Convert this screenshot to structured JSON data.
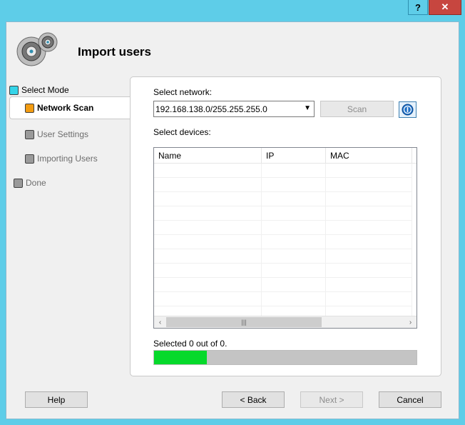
{
  "titlebar": {
    "help_label": "?",
    "close_label": "✕"
  },
  "header": {
    "title": "Import users",
    "logo_icon": "gears-icon"
  },
  "steps": [
    {
      "label": "Select Mode",
      "color": "#35d4e8",
      "state": "done"
    },
    {
      "label": "Network Scan",
      "color": "#f39c12",
      "state": "active"
    },
    {
      "label": "User Settings",
      "color": "#9a9a9a",
      "state": "pending"
    },
    {
      "label": "Importing Users",
      "color": "#9a9a9a",
      "state": "pending"
    },
    {
      "label": "Done",
      "color": "#9a9a9a",
      "state": "pending"
    }
  ],
  "network": {
    "label": "Select network:",
    "selected": "192.168.138.0/255.255.255.0",
    "scan_label": "Scan",
    "info_icon": "info-icon"
  },
  "devices": {
    "label": "Select devices:",
    "columns": [
      "Name",
      "IP",
      "MAC"
    ],
    "rows": []
  },
  "selection": {
    "status": "Selected 0 out of 0.",
    "progress_fraction": 0.2
  },
  "footer": {
    "help_label": "Help",
    "back_label": "< Back",
    "next_label": "Next >",
    "cancel_label": "Cancel"
  },
  "colors": {
    "accent": "#5ecde8",
    "progress": "#06d92b"
  }
}
